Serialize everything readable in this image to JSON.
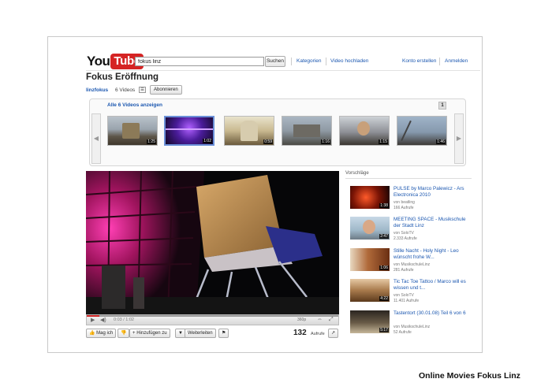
{
  "header": {
    "logo_you": "You",
    "logo_tube": "Tube",
    "search_value": "fokus linz",
    "search_button": "Suchen",
    "links": [
      "Kategorien",
      "Video hochladen",
      "Konto erstellen",
      "Anmelden"
    ]
  },
  "playlist": {
    "title": "Fokus Eröffnung",
    "channel": "linzfokus",
    "count": "6 Videos",
    "dropdown_glyph": "☰",
    "subscribe": "Abonnieren",
    "show_all": "Alle 6 Videos anzeigen",
    "page": "1",
    "thumbs": [
      {
        "duration": "1:25",
        "selected": false
      },
      {
        "duration": "1:02",
        "selected": true
      },
      {
        "duration": "0:59",
        "selected": false
      },
      {
        "duration": "1:16",
        "selected": false
      },
      {
        "duration": "1:15",
        "selected": false
      },
      {
        "duration": "1:46",
        "selected": false
      }
    ]
  },
  "player": {
    "time": "0:03 / 1:02",
    "quality": "360p",
    "progress_fraction": 0.05
  },
  "actions": {
    "like": "Mag ich",
    "add": "Hinzufügen zu",
    "share": "Weiterleiten",
    "views_number": "132",
    "views_label": "Aufrufe"
  },
  "suggestions": {
    "heading": "Vorschläge",
    "items": [
      {
        "title": "PULSE by Marco Palewicz - Ars Electronica 2010",
        "by": "von beatling",
        "views": "166 Aufrufe",
        "duration": "1:38"
      },
      {
        "title": "MEETING SPACE - Musikschule der Stadt Linz",
        "by": "von SoloTV",
        "views": "2.333 Aufrufe",
        "duration": "2:47"
      },
      {
        "title": "Stille Nacht - Holy Night - Leo wünscht frohe W...",
        "by": "von MusikschuleLinz",
        "views": "281 Aufrufe",
        "duration": "1:06"
      },
      {
        "title": "Tic Tac Toe Tattoo / Marco will es wissen und t...",
        "by": "von SoloTV",
        "views": "11.401 Aufrufe",
        "duration": "4:22"
      },
      {
        "title": "Tastentort (30.01.08) Teil 6 von 6",
        "by": "von MusikschuleLinz",
        "views": "52 Aufrufe",
        "duration": "5:17"
      }
    ]
  },
  "caption": "Online Movies Fokus Linz"
}
